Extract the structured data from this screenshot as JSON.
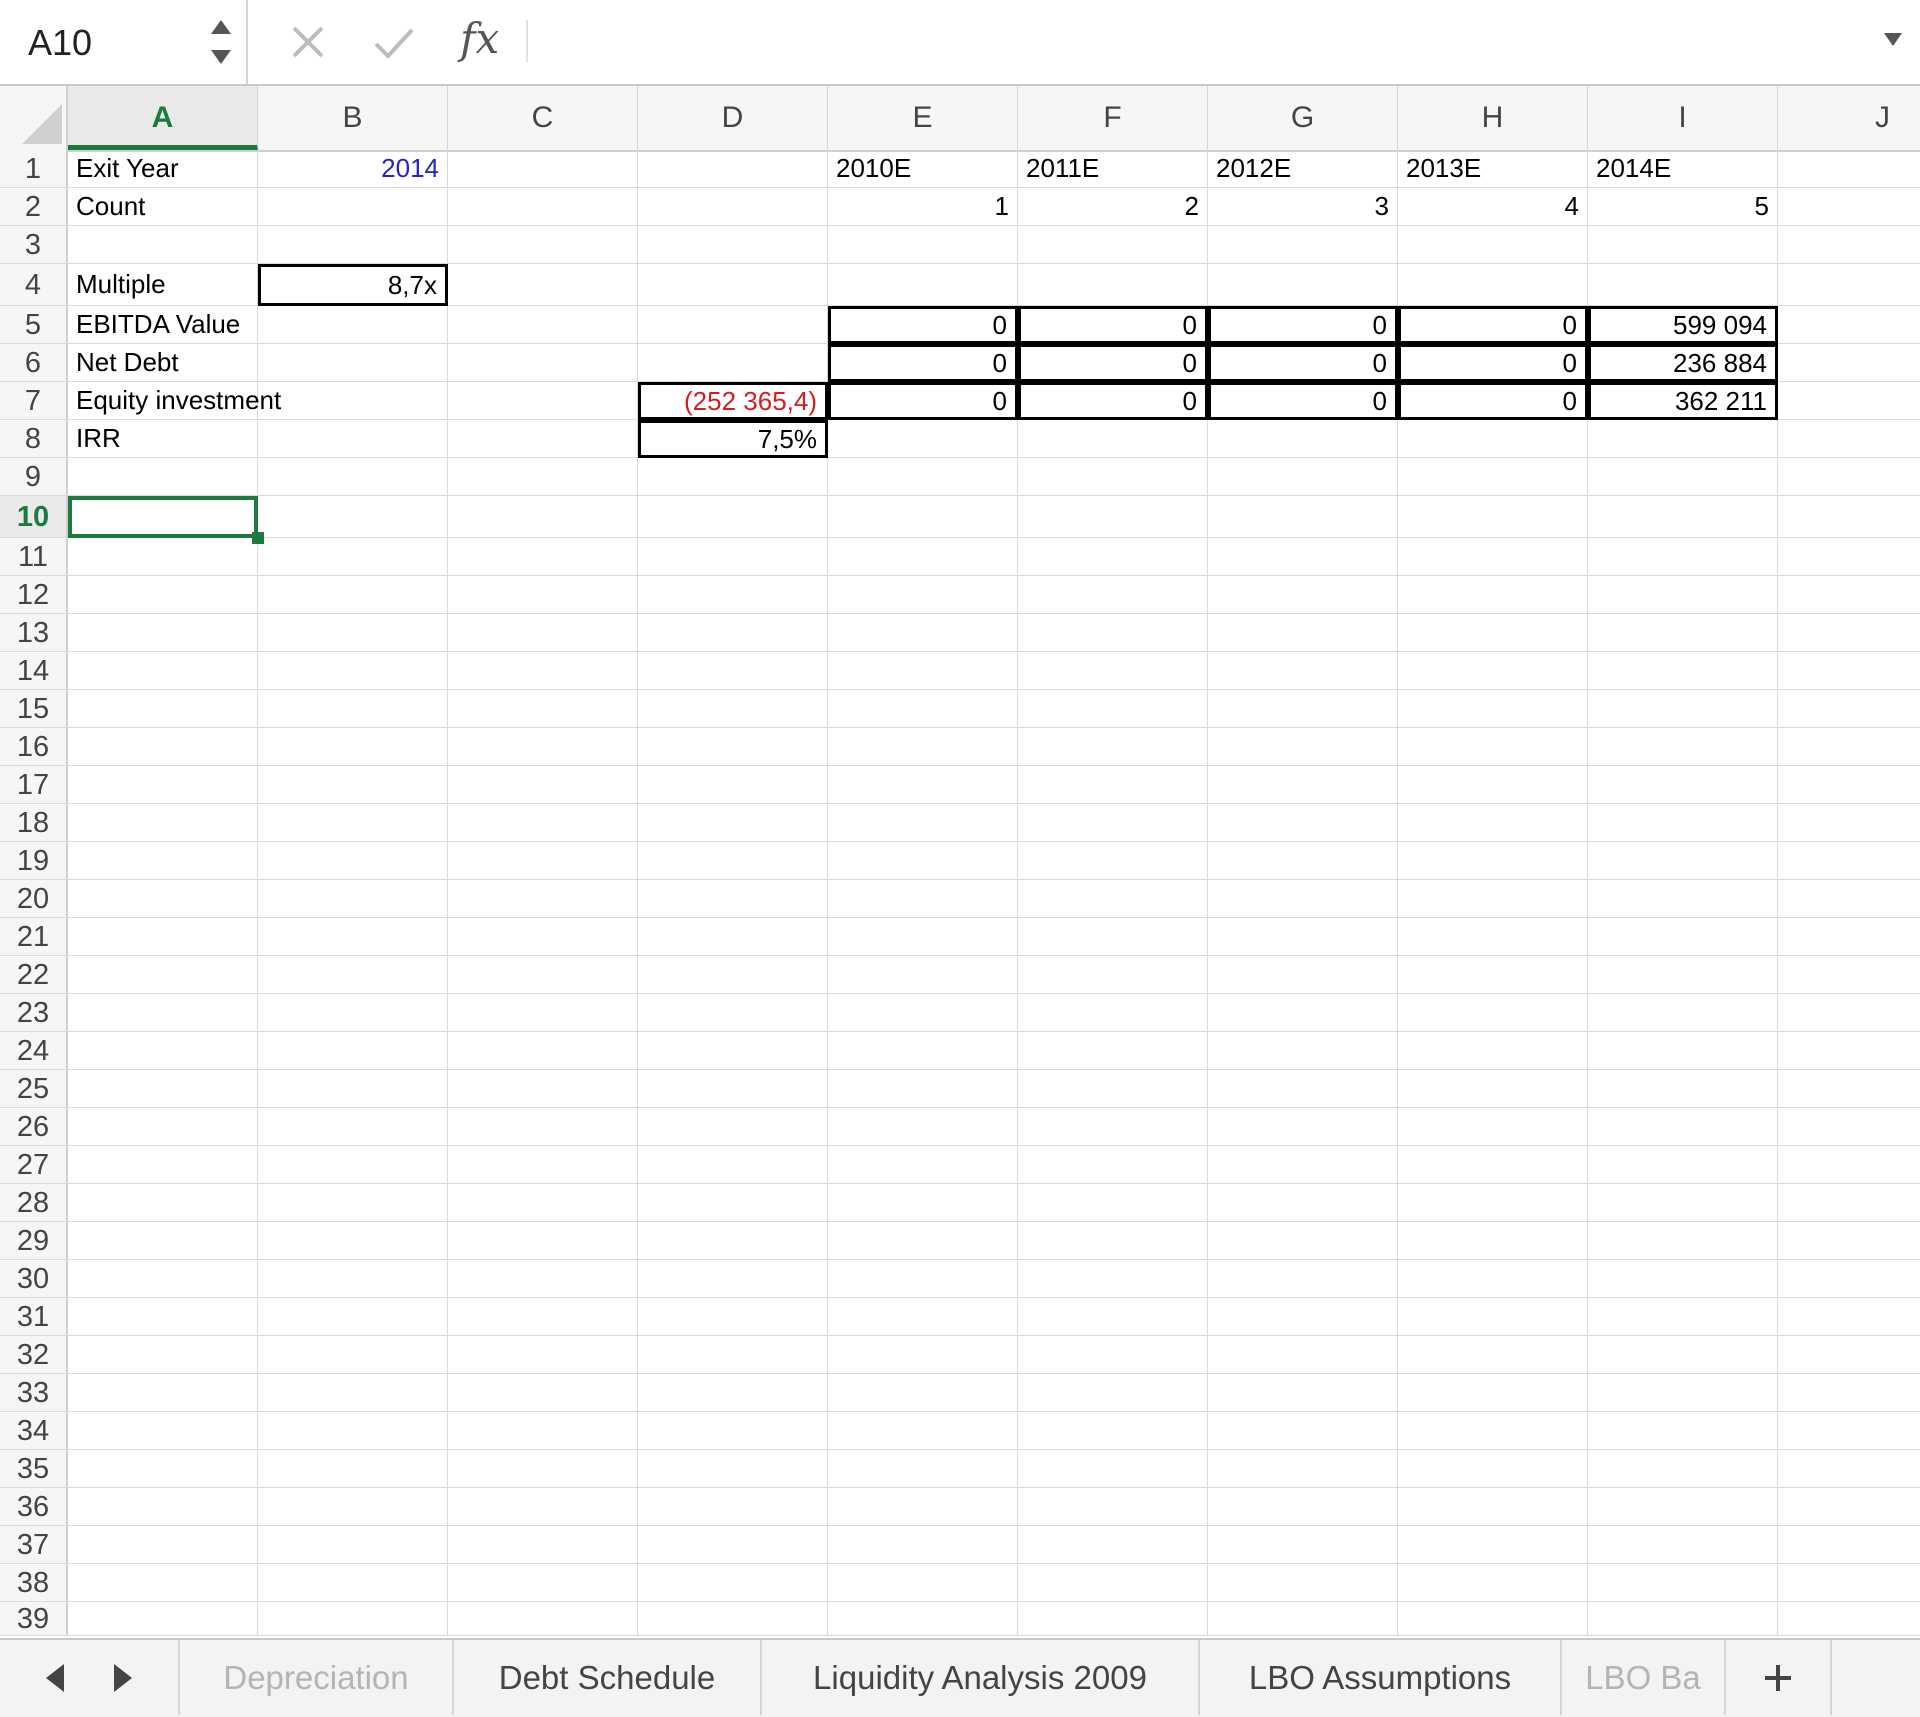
{
  "formula_bar": {
    "name_box": "A10",
    "fx_label": "fx",
    "formula": ""
  },
  "columns": [
    "A",
    "B",
    "C",
    "D",
    "E",
    "F",
    "G",
    "H",
    "I",
    "J"
  ],
  "active_column": "A",
  "rows": [
    "1",
    "2",
    "3",
    "4",
    "5",
    "6",
    "7",
    "8",
    "9",
    "10",
    "11",
    "12",
    "13",
    "14",
    "15",
    "16",
    "17",
    "18",
    "19",
    "20",
    "21",
    "22",
    "23",
    "24",
    "25",
    "26",
    "27",
    "28",
    "29",
    "30",
    "31",
    "32",
    "33",
    "34",
    "35",
    "36",
    "37",
    "38",
    "39"
  ],
  "active_row": "10",
  "cells": {
    "A1": "Exit Year",
    "B1": "2014",
    "E1": "2010E",
    "F1": "2011E",
    "G1": "2012E",
    "H1": "2013E",
    "I1": "2014E",
    "A2": "Count",
    "E2": "1",
    "F2": "2",
    "G2": "3",
    "H2": "4",
    "I2": "5",
    "A4": "Multiple",
    "B4": "8,7x",
    "A5": "EBITDA Value",
    "E5": "0",
    "F5": "0",
    "G5": "0",
    "H5": "0",
    "I5": "599 094",
    "A6": "Net Debt",
    "E6": "0",
    "F6": "0",
    "G6": "0",
    "H6": "0",
    "I6": "236 884",
    "A7": "Equity investment",
    "D7": "(252 365,4)",
    "E7": "0",
    "F7": "0",
    "G7": "0",
    "H7": "0",
    "I7": "362 211",
    "A8": "IRR",
    "D8": "7,5%"
  },
  "colors": {
    "selection": "#1d7a3f",
    "input_blue": "#2323c8",
    "negative_red": "#d21e1e"
  },
  "sheet_tabs": [
    {
      "label": "Depreciation",
      "faded": true
    },
    {
      "label": "Debt Schedule"
    },
    {
      "label": "Liquidity Analysis 2009"
    },
    {
      "label": "LBO Assumptions"
    },
    {
      "label": "LBO Ba",
      "faded": true
    }
  ],
  "icons": [
    "stepper-icon",
    "cancel-icon",
    "confirm-icon",
    "fx-icon",
    "chevron-down-icon",
    "prev-sheet-icon",
    "next-sheet-icon",
    "add-sheet-icon"
  ]
}
